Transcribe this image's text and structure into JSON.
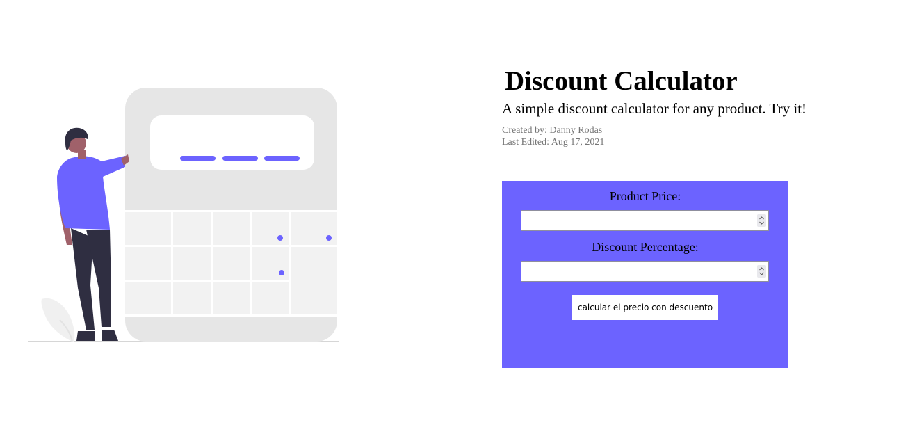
{
  "header": {
    "title": "Discount Calculator",
    "subtitle": "A simple discount calculator for any product. Try it!"
  },
  "meta": {
    "created_by": "Created by: Danny Rodas",
    "last_edited": "Last Edited: Aug 17, 2021"
  },
  "calculator": {
    "price_label": "Product Price:",
    "price_value": "",
    "discount_label": "Discount Percentage:",
    "discount_value": "",
    "submit_label": "calcular el precio con descuento"
  },
  "colors": {
    "accent": "#6c63ff",
    "calculator_body": "#e6e6e6",
    "keypad": "#f2f2f2",
    "person_shirt": "#6c63ff",
    "person_pants": "#2f2e41"
  },
  "icons": {
    "illustration": "person-with-calculator-illustration",
    "spinner": "number-spinner-icon"
  }
}
